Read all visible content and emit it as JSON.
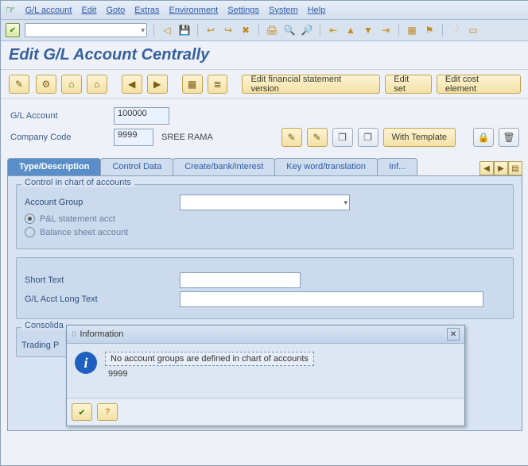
{
  "menu": {
    "items": [
      "G/L account",
      "Edit",
      "Goto",
      "Extras",
      "Environment",
      "Settings",
      "System",
      "Help"
    ]
  },
  "title": "Edit G/L Account Centrally",
  "app_toolbar": {
    "b1": "Edit financial statement version",
    "b2": "Edit set",
    "b3": "Edit cost element"
  },
  "header": {
    "gl_label": "G/L Account",
    "gl_value": "100000",
    "cc_label": "Company Code",
    "cc_value": "9999",
    "cc_desc": "SREE RAMA",
    "with_template": "With Template"
  },
  "tabs": [
    "Type/Description",
    "Control Data",
    "Create/bank/interest",
    "Key word/translation",
    "Inf..."
  ],
  "group1": {
    "legend": "Control in chart of accounts",
    "acct_group": "Account Group",
    "r1": "P&L statement acct",
    "r2": "Balance sheet account"
  },
  "group2": {
    "short": "Short Text",
    "long": "G/L Acct Long Text"
  },
  "group3": {
    "legend": "Consolida",
    "trading": "Trading P"
  },
  "popup": {
    "title": "Information",
    "line1": "No account groups are defined in chart of accounts",
    "line2": "9999"
  }
}
